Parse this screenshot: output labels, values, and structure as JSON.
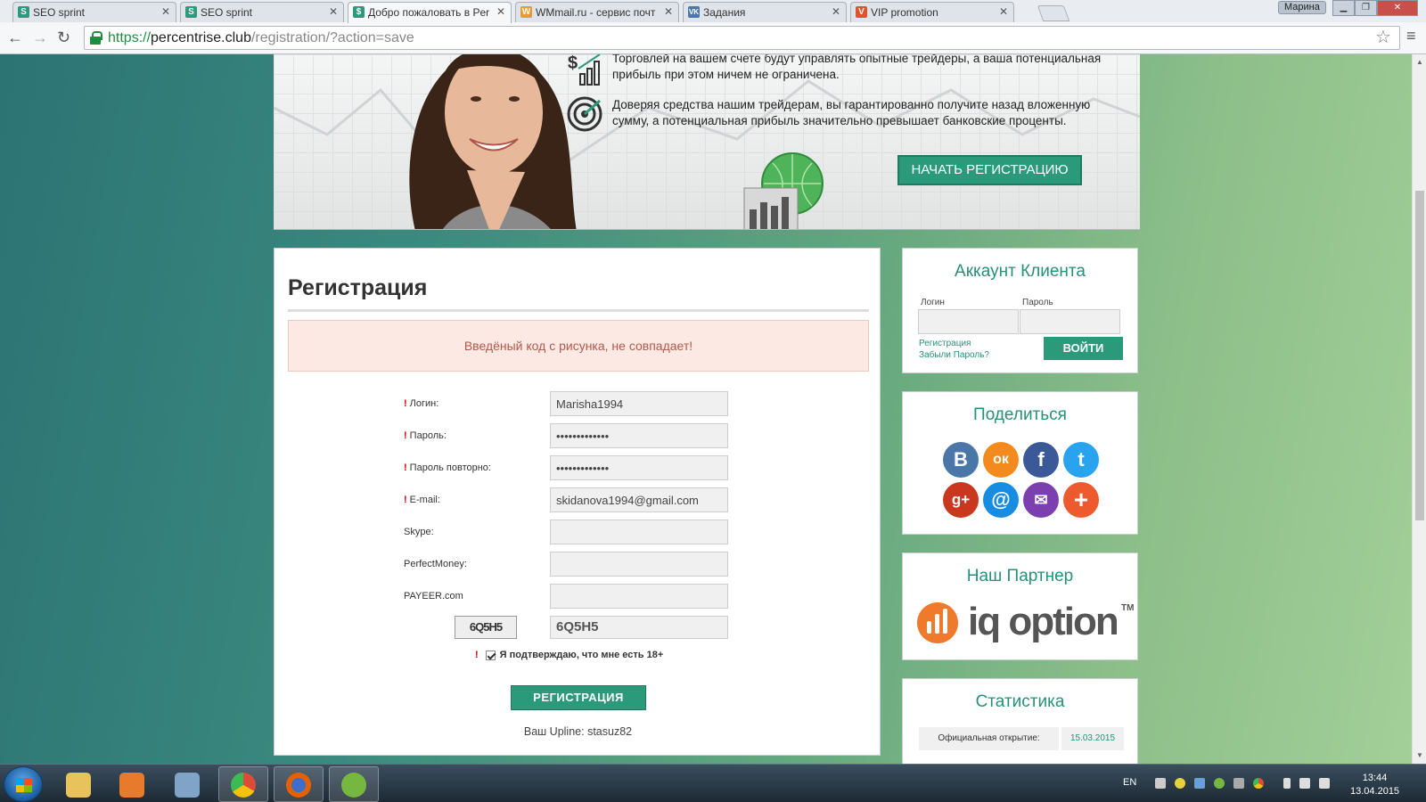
{
  "browser": {
    "tabs": [
      {
        "title": "SEO sprint",
        "icon": "seosprint-icon",
        "color": "#2a9a7b",
        "glyph": "S"
      },
      {
        "title": "SEO sprint",
        "icon": "seosprint-icon",
        "color": "#2a9a7b",
        "glyph": "S"
      },
      {
        "title": "Добро пожаловать в Per",
        "icon": "dollar-icon",
        "color": "#2a9a7b",
        "glyph": "$"
      },
      {
        "title": "WMmail.ru - сервис почт",
        "icon": "wmmail-icon",
        "color": "#e89a2c",
        "glyph": "W"
      },
      {
        "title": "Задания",
        "icon": "vk-icon",
        "color": "#4a76a8",
        "glyph": "VK"
      },
      {
        "title": "VIP promotion",
        "icon": "vip-icon",
        "color": "#e0532b",
        "glyph": "V"
      }
    ],
    "user": "Марина",
    "url": {
      "scheme": "https://",
      "host": "percentrise.club",
      "path": "/registration/?action=save"
    }
  },
  "banner": {
    "line1a": "Торговлей на вашем счете будут управлять опытные трейдеры, а ваша потенциальная",
    "line1b": "прибыль при этом ничем не ограничена.",
    "line2a": "Доверяя средства нашим трейдерам, вы гарантированно получите назад вложенную",
    "line2b": "сумму, а потенциальная прибыль значительно превышает банковские проценты.",
    "cta": "НАЧАТЬ РЕГИСТРАЦИЮ"
  },
  "registration": {
    "title": "Регистрация",
    "error": "Введёный код с рисунка, не совпадает!",
    "fields": [
      {
        "label": "Логин:",
        "required": true,
        "value": "Marisha1994"
      },
      {
        "label": "Пароль:",
        "required": true,
        "value": "•••••••••••••"
      },
      {
        "label": "Пароль повторно:",
        "required": true,
        "value": "•••••••••••••"
      },
      {
        "label": "E-mail:",
        "required": true,
        "value": "skidanova1994@gmail.com"
      },
      {
        "label": "Skype:",
        "required": false,
        "value": ""
      },
      {
        "label": "PerfectMoney:",
        "required": false,
        "value": ""
      },
      {
        "label": "PAYEER.com",
        "required": false,
        "value": ""
      }
    ],
    "required_mark": "!",
    "captcha_image_text": "6Q5H5",
    "captcha_value": "6Q5H5",
    "agree_text": "Я подтверждаю, что мне есть 18+",
    "agree_checked": true,
    "submit": "РЕГИСТРАЦИЯ",
    "upline": "Ваш Upline: stasuz82"
  },
  "account": {
    "title": "Аккаунт Клиента",
    "login_label": "Логин",
    "password_label": "Пароль",
    "register_link": "Регистрация",
    "forgot_link": "Забыли Пароль?",
    "login_button": "ВОЙТИ"
  },
  "share": {
    "title": "Поделиться",
    "networks": [
      {
        "name": "vkontakte-icon",
        "glyph": "В",
        "color": "#4a76a8"
      },
      {
        "name": "odnoklassniki-icon",
        "glyph": "ок",
        "color": "#f28a1e"
      },
      {
        "name": "facebook-icon",
        "glyph": "f",
        "color": "#3b5998"
      },
      {
        "name": "twitter-icon",
        "glyph": "t",
        "color": "#2aa3ef"
      },
      {
        "name": "googleplus-icon",
        "glyph": "g+",
        "color": "#c9371f"
      },
      {
        "name": "mailru-icon",
        "glyph": "@",
        "color": "#168de2"
      },
      {
        "name": "email-icon",
        "glyph": "✉",
        "color": "#7b3fb0"
      },
      {
        "name": "more-icon",
        "glyph": "+",
        "color": "#ec5a2e"
      }
    ]
  },
  "partner": {
    "title": "Наш Партнер",
    "logo_text": "iq option",
    "tm": "TM"
  },
  "stats": {
    "title": "Статистика",
    "open_label": "Официальная открытие:",
    "open_value": "15.03.2015"
  },
  "taskbar": {
    "apps": [
      {
        "name": "explorer-icon",
        "color": "#e8c25a"
      },
      {
        "name": "media-player-icon",
        "color": "#e87a2c"
      },
      {
        "name": "calculator-icon",
        "color": "#7fa4c8"
      },
      {
        "name": "chrome-icon",
        "color": "#dd4b39"
      },
      {
        "name": "firefox-icon",
        "color": "#e66000"
      },
      {
        "name": "utorrent-icon",
        "color": "#76b83f"
      }
    ],
    "lang": "EN",
    "time": "13:44",
    "date": "13.04.2015"
  }
}
